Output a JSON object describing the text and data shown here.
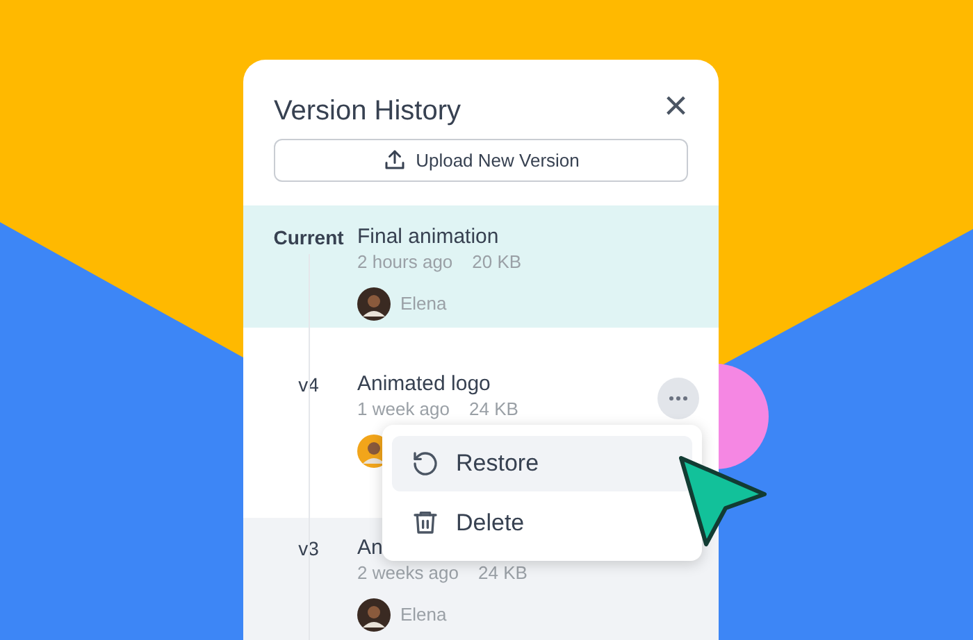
{
  "panel": {
    "title": "Version History",
    "close": "×"
  },
  "upload_button": {
    "label": "Upload New Version"
  },
  "versions": [
    {
      "label": "Current",
      "title": "Final animation",
      "time": "2 hours ago",
      "size": "20 KB",
      "author": "Elena",
      "avatar": {
        "kind": "dark"
      },
      "selected": true,
      "shaded": false,
      "menu_open": false
    },
    {
      "label": "v4",
      "title": "Animated logo",
      "time": "1 week ago",
      "size": "24 KB",
      "avatar": {
        "kind": "light"
      },
      "selected": false,
      "shaded": false,
      "menu_open": true
    },
    {
      "label": "v3",
      "title": "An",
      "time": "2 weeks ago",
      "size": "24 KB",
      "author": "Elena",
      "avatar": {
        "kind": "dark"
      },
      "selected": false,
      "shaded": true,
      "menu_open": false
    }
  ],
  "menu": [
    {
      "kind": "restore",
      "label": "Restore",
      "selected": true
    },
    {
      "kind": "delete",
      "label": "Delete",
      "selected": false
    }
  ]
}
